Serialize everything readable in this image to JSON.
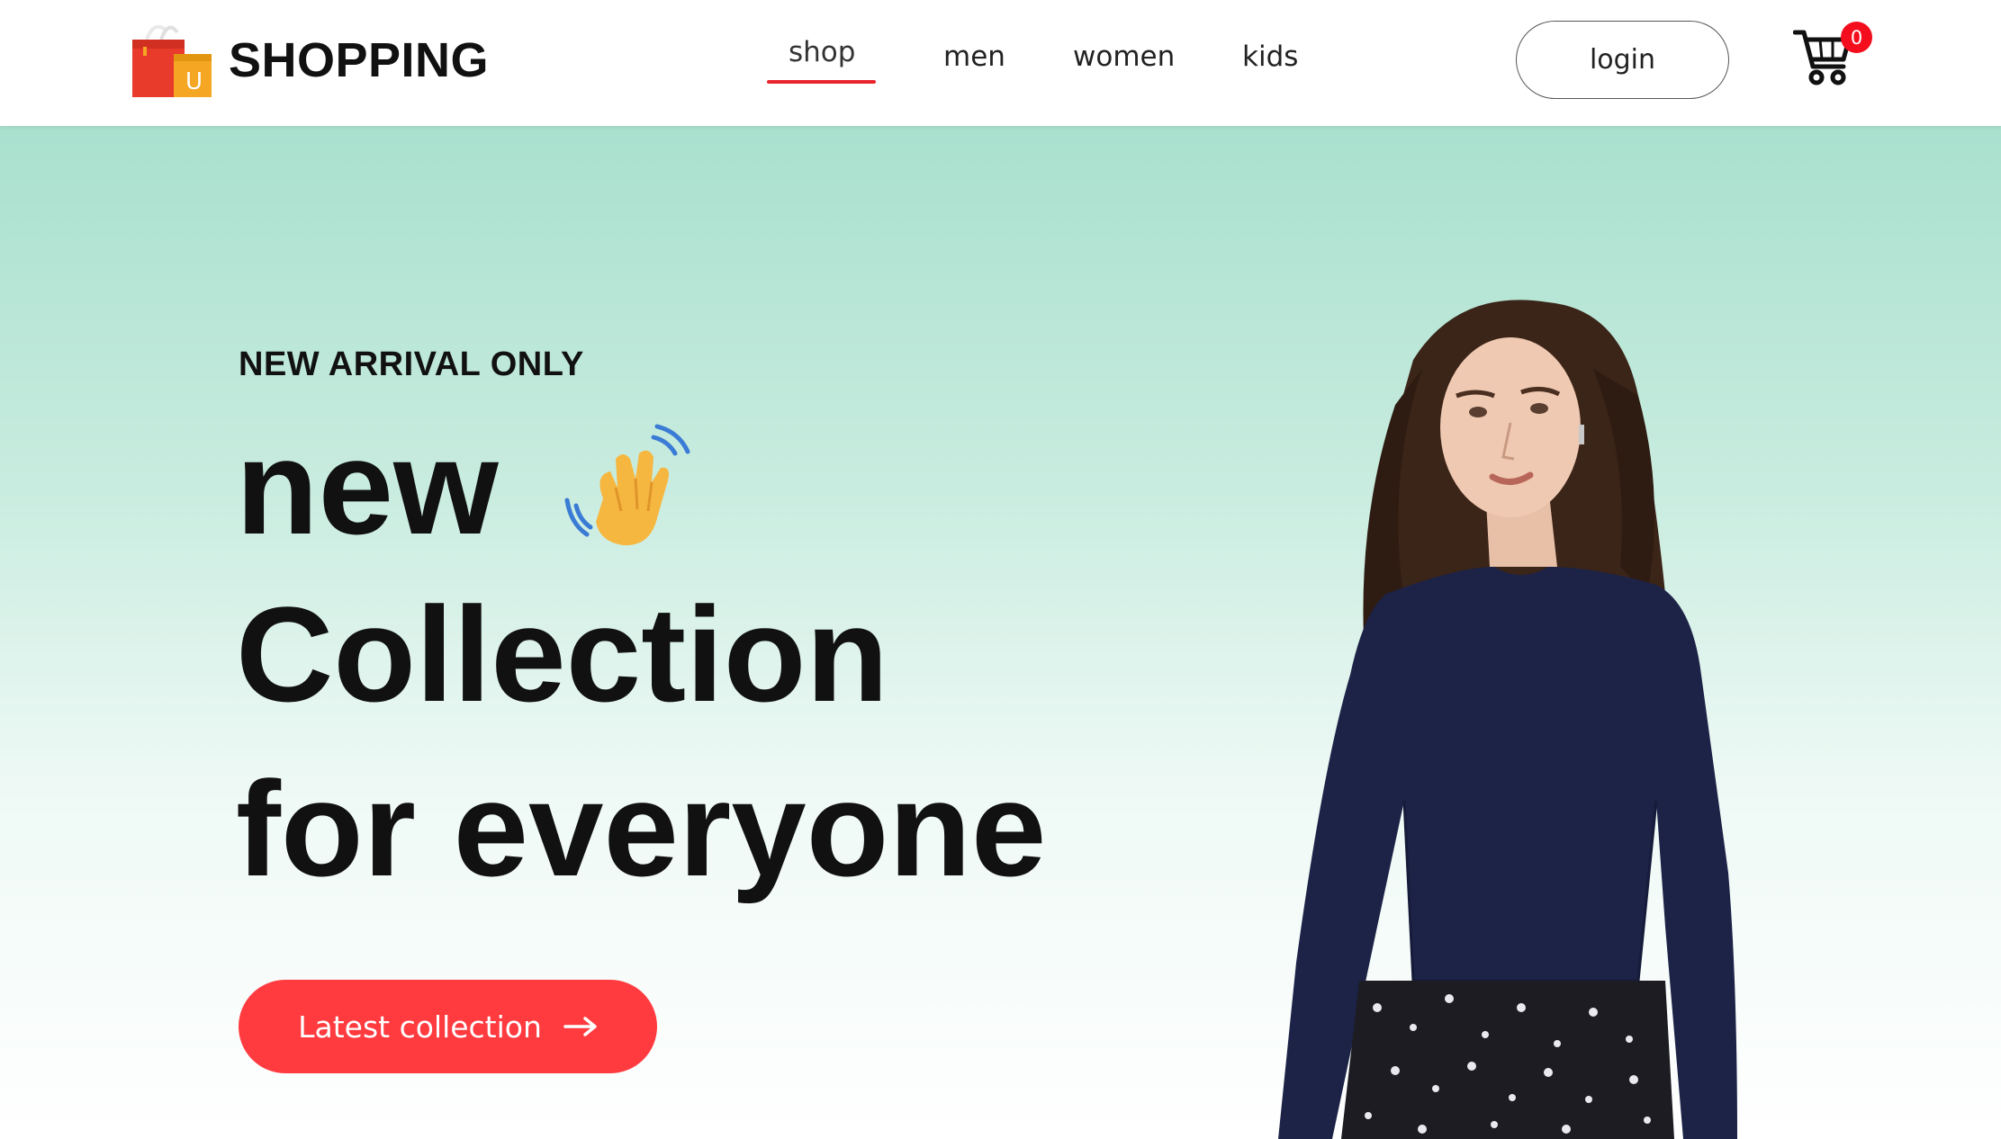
{
  "navbar": {
    "brand": "SHOPPING",
    "logo_icon": "shopping-bag-icon",
    "links": [
      {
        "label": "shop",
        "active": true
      },
      {
        "label": "men",
        "active": false
      },
      {
        "label": "women",
        "active": false
      },
      {
        "label": "kids",
        "active": false
      }
    ],
    "login_label": "login",
    "cart_icon": "cart-icon",
    "cart_count": "0"
  },
  "hero": {
    "eyebrow": "NEW ARRIVAL ONLY",
    "line1": "new",
    "line2": "Collection",
    "line3": "for everyone",
    "emoji": "waving-hand-icon",
    "cta_label": "Latest collection",
    "cta_icon": "arrow-right-icon"
  },
  "colors": {
    "accent": "#ff3b40",
    "active_underline": "#e8252d",
    "badge": "#f40d1d",
    "hero_top": "#a9e0ce",
    "text": "#111111"
  }
}
